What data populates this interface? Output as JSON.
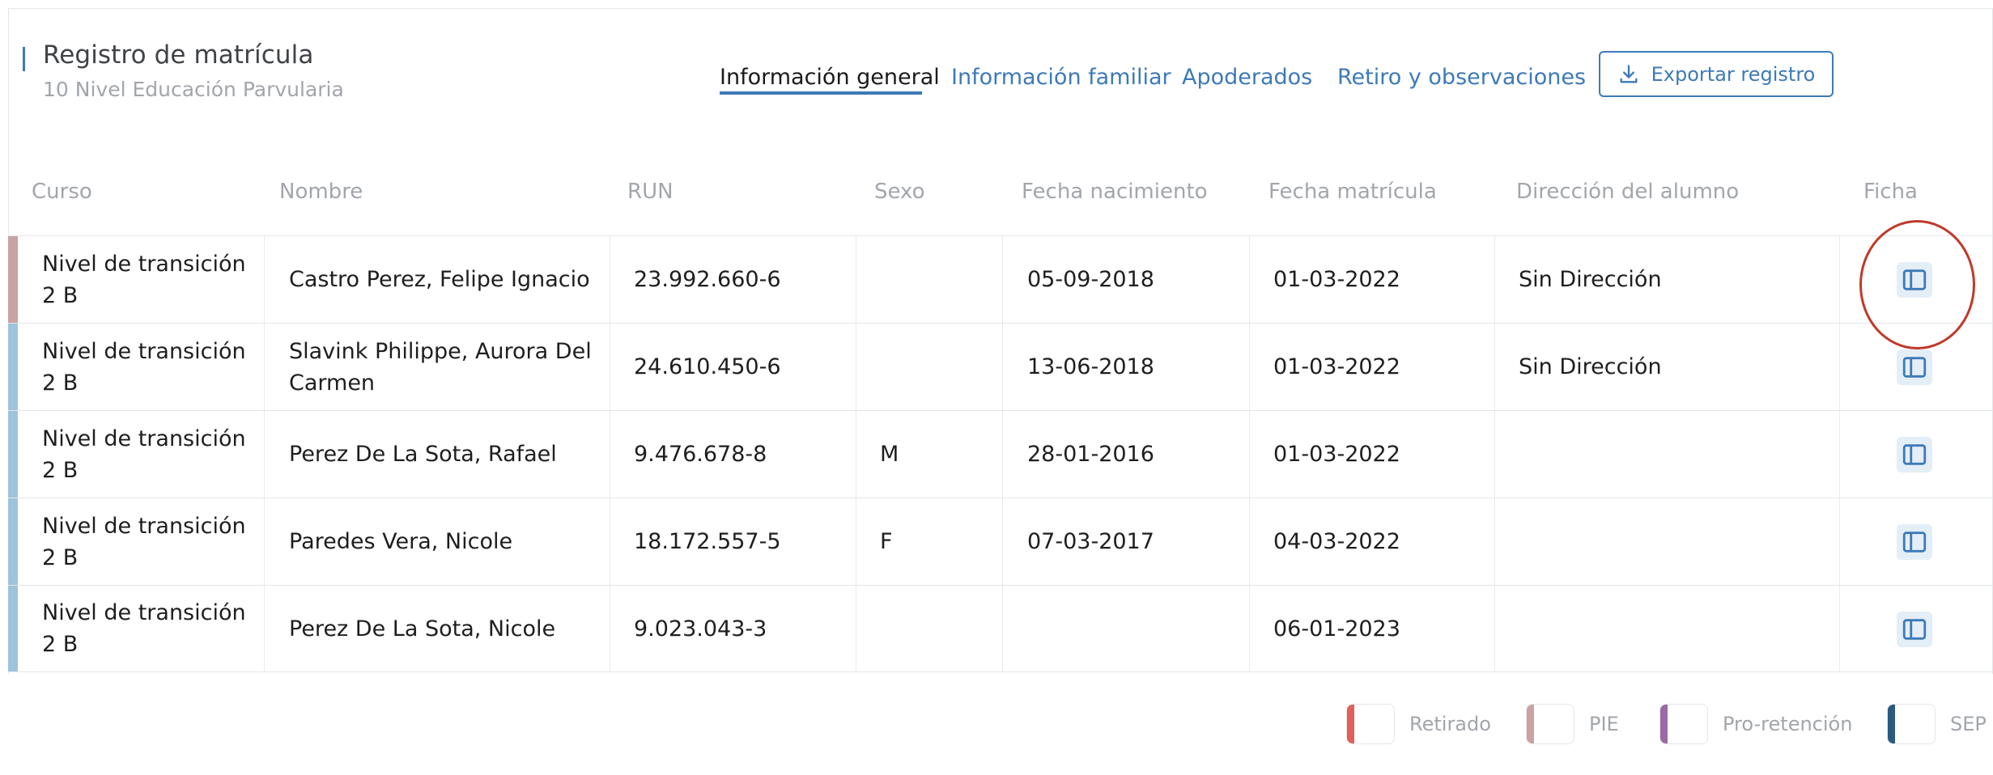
{
  "header": {
    "title": "Registro de matrícula",
    "subtitle": "10 Nivel Educación Parvularia"
  },
  "tabs": [
    {
      "label": "Información general",
      "active": true
    },
    {
      "label": "Información familiar",
      "active": false
    },
    {
      "label": "Apoderados",
      "active": false
    },
    {
      "label": "Retiro y observaciones",
      "active": false
    }
  ],
  "export_button": {
    "label": "Exportar registro",
    "icon": "download-icon"
  },
  "table": {
    "columns": [
      "Curso",
      "Nombre",
      "RUN",
      "Sexo",
      "Fecha nacimiento",
      "Fecha matrícula",
      "Dirección del alumno",
      "Ficha"
    ],
    "rows": [
      {
        "curso_1": "Nivel de transición",
        "curso_2": "2 B",
        "nombre_1": "Castro Perez, Felipe Ignacio",
        "nombre_2": "",
        "run": "23.992.660-6",
        "sexo": "",
        "fecha_nacimiento": "05-09-2018",
        "fecha_matricula": "01-03-2022",
        "direccion": "Sin Dirección",
        "stripe_color": "#c9a3a3"
      },
      {
        "curso_1": "Nivel de transición",
        "curso_2": "2 B",
        "nombre_1": "Slavink Philippe, Aurora Del",
        "nombre_2": "Carmen",
        "run": "24.610.450-6",
        "sexo": "",
        "fecha_nacimiento": "13-06-2018",
        "fecha_matricula": "01-03-2022",
        "direccion": "Sin Dirección",
        "stripe_color": "#9ec3dc"
      },
      {
        "curso_1": "Nivel de transición",
        "curso_2": "2 B",
        "nombre_1": "Perez De La Sota, Rafael",
        "nombre_2": "",
        "run": "9.476.678-8",
        "sexo": "M",
        "fecha_nacimiento": "28-01-2016",
        "fecha_matricula": "01-03-2022",
        "direccion": "",
        "stripe_color": "#9ec3dc"
      },
      {
        "curso_1": "Nivel de transición",
        "curso_2": "2 B",
        "nombre_1": "Paredes Vera, Nicole",
        "nombre_2": "",
        "run": "18.172.557-5",
        "sexo": "F",
        "fecha_nacimiento": "07-03-2017",
        "fecha_matricula": "04-03-2022",
        "direccion": "",
        "stripe_color": "#9ec3dc"
      },
      {
        "curso_1": "Nivel de transición",
        "curso_2": "2 B",
        "nombre_1": "Perez De La Sota, Nicole",
        "nombre_2": "",
        "run": "9.023.043-3",
        "sexo": "",
        "fecha_nacimiento": "",
        "fecha_matricula": "06-01-2023",
        "direccion": "",
        "stripe_color": "#9ec3dc"
      }
    ],
    "ficha_icon": "sidebar-panel-icon"
  },
  "legend": [
    {
      "label": "Retirado",
      "color": "#e0605a"
    },
    {
      "label": "PIE",
      "color": "#c9a3a3"
    },
    {
      "label": "Pro-retención",
      "color": "#9a6aa8"
    },
    {
      "label": "SEP",
      "color": "#2c5a7f"
    }
  ],
  "colors": {
    "accent": "#3d7ab8",
    "highlight": "#c0392b"
  }
}
